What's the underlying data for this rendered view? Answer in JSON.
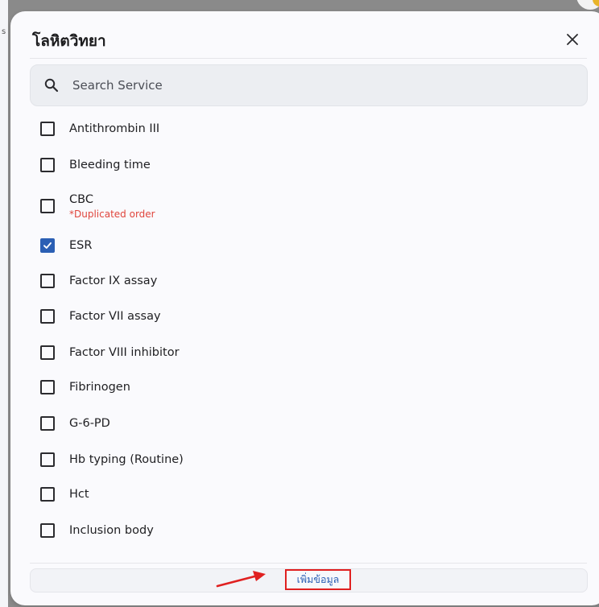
{
  "backdrop": {
    "edge_mark": "s"
  },
  "dialog": {
    "title": "โลหิตวิทยา",
    "search": {
      "placeholder": "Search Service",
      "value": ""
    },
    "items": [
      {
        "label": "Antithrombin III",
        "checked": false
      },
      {
        "label": "Bleeding time",
        "checked": false
      },
      {
        "label": "CBC",
        "checked": false,
        "note": "*Duplicated order"
      },
      {
        "label": "ESR",
        "checked": true
      },
      {
        "label": "Factor IX assay",
        "checked": false
      },
      {
        "label": "Factor VII assay",
        "checked": false
      },
      {
        "label": "Factor VIII inhibitor",
        "checked": false
      },
      {
        "label": "Fibrinogen",
        "checked": false
      },
      {
        "label": "G-6-PD",
        "checked": false
      },
      {
        "label": "Hb typing (Routine)",
        "checked": false
      },
      {
        "label": "Hct",
        "checked": false
      },
      {
        "label": "Inclusion body",
        "checked": false
      }
    ],
    "add_button_label": "เพิ่มข้อมูล"
  },
  "colors": {
    "accent": "#2b5fb4",
    "warning_text": "#e0453c",
    "annotation_red": "#e02020",
    "dialog_bg": "#fafafd",
    "search_bg": "#eceef2"
  },
  "icons": {
    "close": "close-icon",
    "search": "search-icon",
    "checkbox_checked": "checkmark-icon",
    "annotation": "arrow-annotation-icon"
  }
}
